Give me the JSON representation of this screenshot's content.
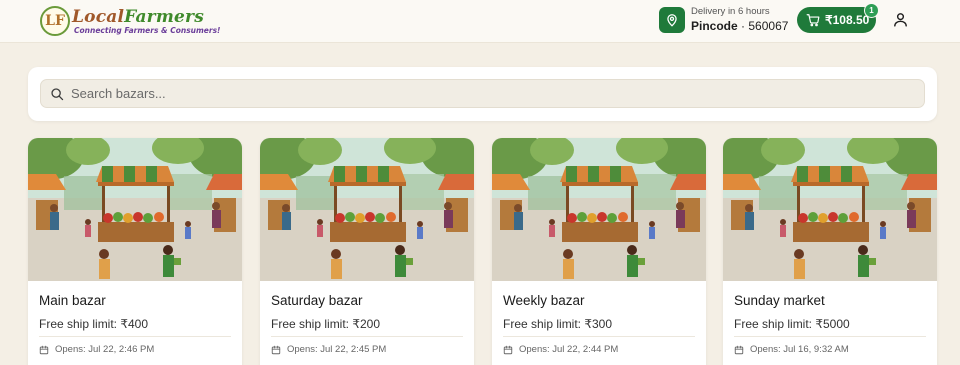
{
  "brand": {
    "name_part1": "Local",
    "name_part2": "Farmers",
    "tagline": "Connecting Farmers & Consumers!",
    "mark": "LF"
  },
  "header": {
    "delivery_eta": "Delivery in 6 hours",
    "pincode_label": "Pincode",
    "pincode_sep": "·",
    "pincode_value": "560067",
    "cart_total": "₹108.50",
    "cart_count": "1"
  },
  "search": {
    "placeholder": "Search bazars..."
  },
  "bazars": [
    {
      "name": "Main bazar",
      "ship_limit": "Free ship limit: ₹400",
      "opens": "Opens: Jul 22, 2:46 PM"
    },
    {
      "name": "Saturday bazar",
      "ship_limit": "Free ship limit: ₹200",
      "opens": "Opens: Jul 22, 2:45 PM"
    },
    {
      "name": "Weekly bazar",
      "ship_limit": "Free ship limit: ₹300",
      "opens": "Opens: Jul 22, 2:44 PM"
    },
    {
      "name": "Sunday market",
      "ship_limit": "Free ship limit: ₹5000",
      "opens": "Opens: Jul 16, 9:32 AM"
    }
  ],
  "icons": {
    "location": "location-pin-icon",
    "cart": "shopping-cart-icon",
    "user": "user-icon",
    "search": "search-icon",
    "calendar": "calendar-icon"
  },
  "colors": {
    "primary": "#1f7a3a",
    "badge": "#2e9e55",
    "background": "#f4efe5"
  }
}
